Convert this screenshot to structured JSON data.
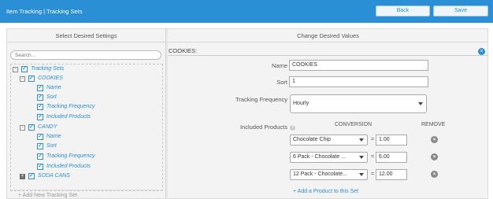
{
  "topbar": {
    "title": "Item Tracking | Tracking Sets",
    "back_label": "Back",
    "save_label": "Save"
  },
  "left_panel": {
    "header": "Select Desired Settings",
    "search_placeholder": "Search...",
    "tree": {
      "root": "Tracking Sets",
      "sets": [
        {
          "name": "COOKIES",
          "expanded": true,
          "checked": true,
          "children": [
            "Name",
            "Sort",
            "Tracking Frequency",
            "Included Products"
          ]
        },
        {
          "name": "CANDY",
          "expanded": true,
          "checked": true,
          "children": [
            "Name",
            "Sort",
            "Tracking Frequency",
            "Included Products"
          ]
        },
        {
          "name": "SODA CANS",
          "expanded": false,
          "checked": true,
          "children": []
        }
      ]
    },
    "add_set_label": "+ Add New Tracking Set"
  },
  "right_panel": {
    "header": "Change Desired Values",
    "section_title": "COOKIES:",
    "fields": {
      "name_label": "Name",
      "name_value": "COOKIES",
      "sort_label": "Sort",
      "sort_value": "1",
      "frequency_label": "Tracking Frequency",
      "frequency_value": "Hourly",
      "products_label": "Included Products"
    },
    "products_table": {
      "conversion_header": "CONVERSION",
      "remove_header": "REMOVE",
      "rows": [
        {
          "product": "Chocolate Chip",
          "conversion": "1.00"
        },
        {
          "product": "6 Pack - Chocolate ...",
          "conversion": "6.00"
        },
        {
          "product": "12 Pack - Chocolate...",
          "conversion": "12.00"
        }
      ]
    },
    "add_product_label": "+ Add a Product to this Set"
  },
  "icons": {
    "help": "help-icon",
    "close": "close-icon",
    "remove": "remove-icon",
    "checkbox": "checkbox-icon",
    "expand": "expand-icon",
    "collapse": "collapse-icon"
  },
  "colors": {
    "accent": "#2b8fd6",
    "panel_bg": "#f3f3f3"
  }
}
